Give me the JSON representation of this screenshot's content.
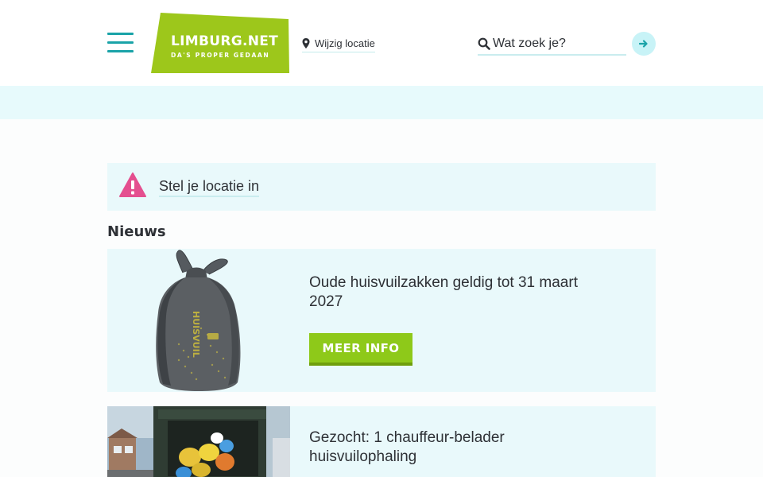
{
  "header": {
    "logo": {
      "name": "LIMBURG.NET",
      "tagline": "DA'S PROPER GEDAAN",
      "color": "#9dc71b"
    },
    "menu_icon": "hamburger-menu-icon",
    "location_link": {
      "icon": "map-pin-icon",
      "label": "Wijzig locatie"
    },
    "search": {
      "icon": "search-icon",
      "placeholder": "Wat zoek je?",
      "submit_icon": "arrow-right-icon"
    }
  },
  "alert": {
    "icon": "warning-triangle-icon",
    "icon_color": "#e44f8f",
    "label": "Stel je locatie in"
  },
  "news": {
    "heading": "Nieuws",
    "items": [
      {
        "title": "Oude huisvuilzakken geldig tot 31 maart 2027",
        "button_label": "MEER INFO",
        "image": "grey-garbage-bag",
        "bag_print": "HUISVUIL"
      },
      {
        "title": "Gezocht: 1 chauffeur-belader huisvuilophaling",
        "image": "garbage-truck-with-bags"
      }
    ]
  },
  "colors": {
    "accent_teal": "#1aa3a8",
    "accent_green": "#8ec919",
    "card_background": "#e9f9fb"
  }
}
